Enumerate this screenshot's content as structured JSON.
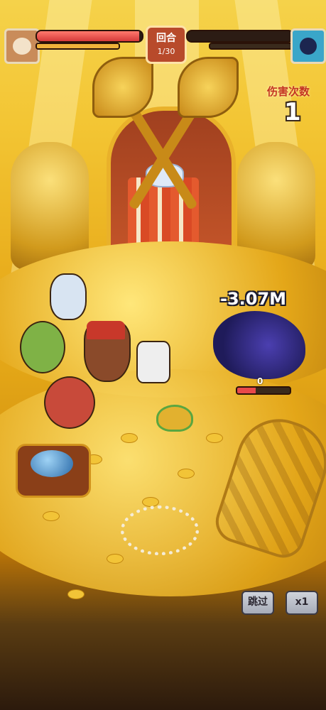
{
  "hud": {
    "round_label": "回合",
    "round_counter": "1/30",
    "hit_count_label": "伤害次数",
    "hit_count_value": "1",
    "player_hp_fraction": 0.97,
    "enemy_hp_fraction": 0.0,
    "player_avatar_icon": "otter-hero-icon",
    "enemy_avatar_icon": "shadow-boss-icon"
  },
  "battle": {
    "damage_popup": "-3.07M",
    "enemy_small_hp_value": "0",
    "enemy_small_hp_fraction": 0.35
  },
  "controls": {
    "skip_label": "跳过",
    "speed_label": "x1"
  },
  "colors": {
    "player_hp": "#e8494a",
    "enemy_hp": "#e84a4a",
    "gold": "#f2c437",
    "round_box": "#b84a2b"
  }
}
